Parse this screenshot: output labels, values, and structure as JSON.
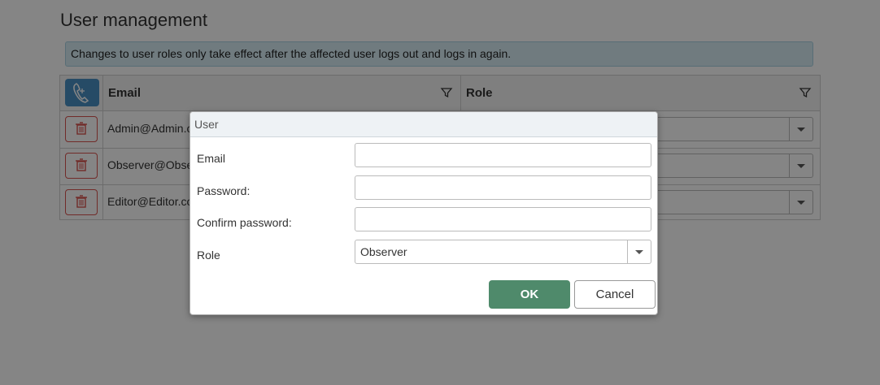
{
  "page": {
    "title": "User management",
    "alert": "Changes to user roles only take effect after the affected user logs out and logs in again."
  },
  "grid": {
    "columns": {
      "email": "Email",
      "role": "Role"
    },
    "add_icon": "add-user-phone-icon",
    "filter_icon": "funnel-icon",
    "delete_icon": "trash-icon",
    "rows": [
      {
        "email": "Admin@Admin.c"
      },
      {
        "email": "Observer@Obse"
      },
      {
        "email": "Editor@Editor.co"
      }
    ]
  },
  "dialog": {
    "title": "User",
    "fields": {
      "email_label": "Email",
      "email_value": "",
      "password_label": "Password:",
      "password_value": "",
      "confirm_label": "Confirm password:",
      "confirm_value": "",
      "role_label": "Role",
      "role_value": "Observer"
    },
    "buttons": {
      "ok": "OK",
      "cancel": "Cancel"
    }
  },
  "colors": {
    "accent": "#4a90c4",
    "ok_button": "#4f8a6b",
    "delete": "#d9534f",
    "alert_bg": "#d6ecf4"
  }
}
